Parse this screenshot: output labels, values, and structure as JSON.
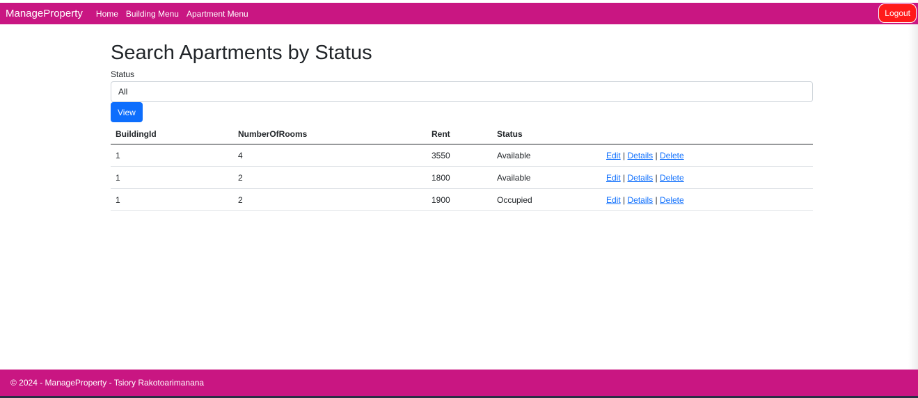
{
  "navbar": {
    "brand": "ManageProperty",
    "links": [
      "Home",
      "Building Menu",
      "Apartment Menu"
    ],
    "logout_label": "Logout"
  },
  "main": {
    "title": "Search Apartments by Status",
    "status_label": "Status",
    "status_value": "All",
    "view_label": "View"
  },
  "table": {
    "headers": [
      "BuildingId",
      "NumberOfRooms",
      "Rent",
      "Status"
    ],
    "rows": [
      {
        "building_id": "1",
        "rooms": "4",
        "rent": "3550",
        "status": "Available"
      },
      {
        "building_id": "1",
        "rooms": "2",
        "rent": "1800",
        "status": "Available"
      },
      {
        "building_id": "1",
        "rooms": "2",
        "rent": "1900",
        "status": "Occupied"
      }
    ],
    "actions": {
      "edit": "Edit",
      "details": "Details",
      "delete": "Delete",
      "separator": "|"
    }
  },
  "footer": {
    "text": "© 2024 - ManageProperty - Tsiory Rakotoarimanana"
  },
  "colors": {
    "brand": "#c91682",
    "primary": "#0d6efd",
    "logout": "#ff1a1a"
  }
}
